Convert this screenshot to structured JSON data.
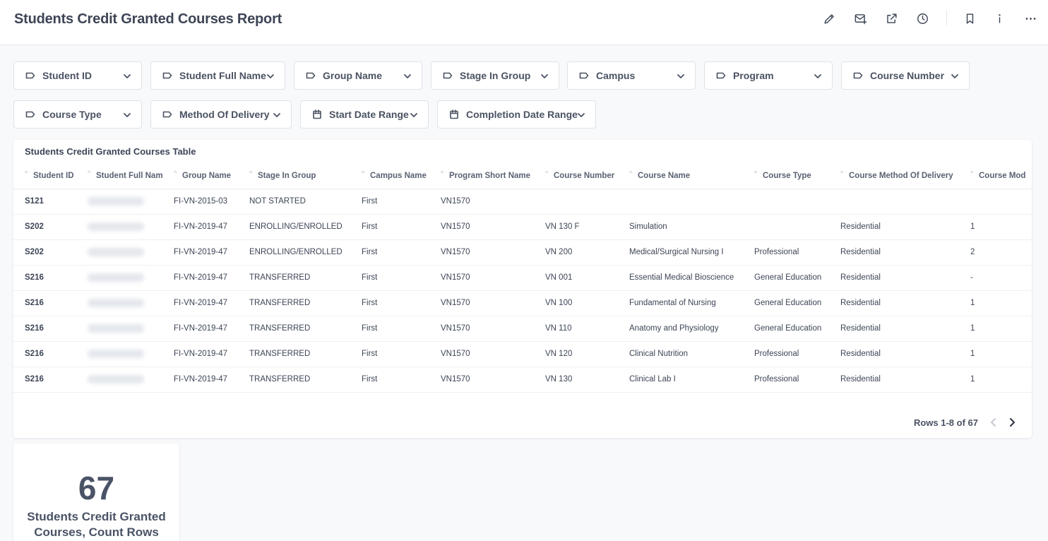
{
  "header": {
    "title": "Students Credit Granted Courses Report",
    "tools": [
      "edit-icon",
      "schedule-delivery-icon",
      "share-icon",
      "history-icon",
      "bookmark-icon",
      "info-icon",
      "more-icon"
    ]
  },
  "filters": [
    {
      "label": "Student ID",
      "icon": "tag-icon"
    },
    {
      "label": "Student Full Name",
      "icon": "tag-icon"
    },
    {
      "label": "Group Name",
      "icon": "tag-icon"
    },
    {
      "label": "Stage In Group",
      "icon": "tag-icon"
    },
    {
      "label": "Campus",
      "icon": "tag-icon"
    },
    {
      "label": "Program",
      "icon": "tag-icon"
    },
    {
      "label": "Course Number",
      "icon": "tag-icon"
    },
    {
      "label": "Course Type",
      "icon": "tag-icon"
    },
    {
      "label": "Method Of Delivery",
      "icon": "tag-icon"
    },
    {
      "label": "Start Date Range",
      "icon": "calendar-icon"
    },
    {
      "label": "Completion Date Range",
      "icon": "calendar-icon"
    }
  ],
  "table": {
    "title": "Students Credit Granted Courses Table",
    "columns": [
      "Student ID",
      "Student Full Name",
      "Group Name",
      "Stage In Group",
      "Campus Name",
      "Program Short Name",
      "Course Number",
      "Course Name",
      "Course Type",
      "Course Method Of Delivery",
      "Course Mod"
    ],
    "rows": [
      [
        "S121",
        "",
        "FI-VN-2015-03",
        "NOT STARTED",
        "First",
        "VN1570",
        "",
        "",
        "",
        "",
        ""
      ],
      [
        "S202",
        "",
        "FI-VN-2019-47",
        "ENROLLING/ENROLLED",
        "First",
        "VN1570",
        "VN 130 F",
        "Simulation",
        "",
        "Residential",
        "1"
      ],
      [
        "S202",
        "",
        "FI-VN-2019-47",
        "ENROLLING/ENROLLED",
        "First",
        "VN1570",
        "VN 200",
        "Medical/Surgical Nursing I",
        "Professional",
        "Residential",
        "2"
      ],
      [
        "S216",
        "",
        "FI-VN-2019-47",
        "TRANSFERRED",
        "First",
        "VN1570",
        "VN 001",
        "Essential Medical Bioscience",
        "General Education",
        "Residential",
        "-"
      ],
      [
        "S216",
        "",
        "FI-VN-2019-47",
        "TRANSFERRED",
        "First",
        "VN1570",
        "VN 100",
        "Fundamental of Nursing",
        "General Education",
        "Residential",
        "1"
      ],
      [
        "S216",
        "",
        "FI-VN-2019-47",
        "TRANSFERRED",
        "First",
        "VN1570",
        "VN 110",
        "Anatomy and Physiology",
        "General Education",
        "Residential",
        "1"
      ],
      [
        "S216",
        "",
        "FI-VN-2019-47",
        "TRANSFERRED",
        "First",
        "VN1570",
        "VN 120",
        "Clinical Nutrition",
        "Professional",
        "Residential",
        "1"
      ],
      [
        "S216",
        "",
        "FI-VN-2019-47",
        "TRANSFERRED",
        "First",
        "VN1570",
        "VN 130",
        "Clinical Lab I",
        "Professional",
        "Residential",
        "1"
      ]
    ],
    "pagination": "Rows 1-8 of 67"
  },
  "kpi": {
    "value": "67",
    "label": "Students Credit Granted Courses, Count Rows"
  },
  "colors": {
    "text": "#3d4556",
    "background": "#f8f9fb",
    "card": "#ffffff",
    "border": "#dfe2e7"
  }
}
